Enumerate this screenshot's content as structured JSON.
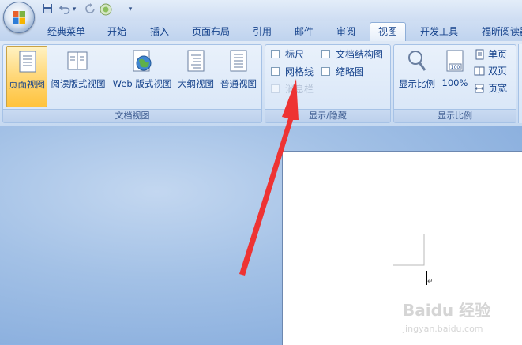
{
  "window": {
    "title": ""
  },
  "qat": {
    "dropdown_glyph": "▾"
  },
  "tabs": [
    {
      "label": "经典菜单"
    },
    {
      "label": "开始"
    },
    {
      "label": "插入"
    },
    {
      "label": "页面布局"
    },
    {
      "label": "引用"
    },
    {
      "label": "邮件"
    },
    {
      "label": "审阅"
    },
    {
      "label": "视图",
      "active": true
    },
    {
      "label": "开发工具"
    },
    {
      "label": "福昕阅读器"
    }
  ],
  "ribbon": {
    "doc_views": {
      "label": "文档视图",
      "buttons": [
        {
          "label": "页面视图",
          "icon": "page-view-icon",
          "selected": true
        },
        {
          "label": "阅读版式视图",
          "icon": "reading-layout-icon"
        },
        {
          "label": "Web 版式视图",
          "icon": "web-layout-icon"
        },
        {
          "label": "大纲视图",
          "icon": "outline-view-icon"
        },
        {
          "label": "普通视图",
          "icon": "draft-view-icon"
        }
      ]
    },
    "show_hide": {
      "label": "显示/隐藏",
      "items": [
        {
          "label": "标尺",
          "checked": false
        },
        {
          "label": "网格线",
          "checked": false
        },
        {
          "label": "消息栏",
          "checked": false,
          "disabled": true
        },
        {
          "label": "文档结构图",
          "checked": false
        },
        {
          "label": "缩略图",
          "checked": false
        }
      ]
    },
    "zoom": {
      "label": "显示比例",
      "zoom_button": "显示比例",
      "percent_button": "100%",
      "percent_icon_text": "100",
      "page_buttons": [
        {
          "label": "单页",
          "icon": "one-page-icon"
        },
        {
          "label": "双页",
          "icon": "two-pages-icon"
        },
        {
          "label": "页宽",
          "icon": "page-width-icon"
        }
      ]
    }
  },
  "colors": {
    "accent": "#15428b",
    "ribbon_bg": "#dfe9f6",
    "selected_button": "#ffd571",
    "arrow": "#ee3333"
  },
  "watermark": {
    "text": "Baidu 经验",
    "url_text": "jingyan.baidu.com"
  }
}
